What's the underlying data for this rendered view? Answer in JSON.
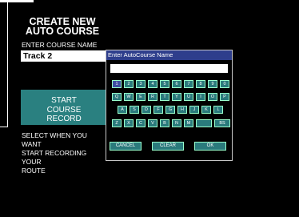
{
  "screen": {
    "title_line1": "CREATE NEW",
    "title_line2": "AUTO COURSE",
    "course_label": "ENTER COURSE NAME",
    "course_value": "Track 2",
    "start_line1": "START",
    "start_line2": "COURSE",
    "start_line3": "RECORD",
    "instr_line1": "SELECT WHEN YOU WANT",
    "instr_line2": "START RECORDING YOUR",
    "instr_line3": "ROUTE"
  },
  "dialog": {
    "title": "Enter AutoCourse Name",
    "input_value": "",
    "row1": [
      "1",
      "2",
      "3",
      "4",
      "5",
      "6",
      "7",
      "8",
      "9",
      "0"
    ],
    "row2": [
      "Q",
      "W",
      "E",
      "R",
      "T",
      "Y",
      "U",
      "I",
      "O",
      "P"
    ],
    "row3": [
      "A",
      "S",
      "D",
      "F",
      "G",
      "H",
      "J",
      "K",
      "L"
    ],
    "row4": [
      "Z",
      "X",
      "C",
      "V",
      "B",
      "N",
      "M",
      "",
      "BS"
    ],
    "cancel": "CANCEL",
    "clear": "CLEAR",
    "ok": "OK"
  },
  "colors": {
    "accent": "#2a8080",
    "dialog_title_bg": "#2e3e8c",
    "selected_key": "#3f4fa4"
  }
}
